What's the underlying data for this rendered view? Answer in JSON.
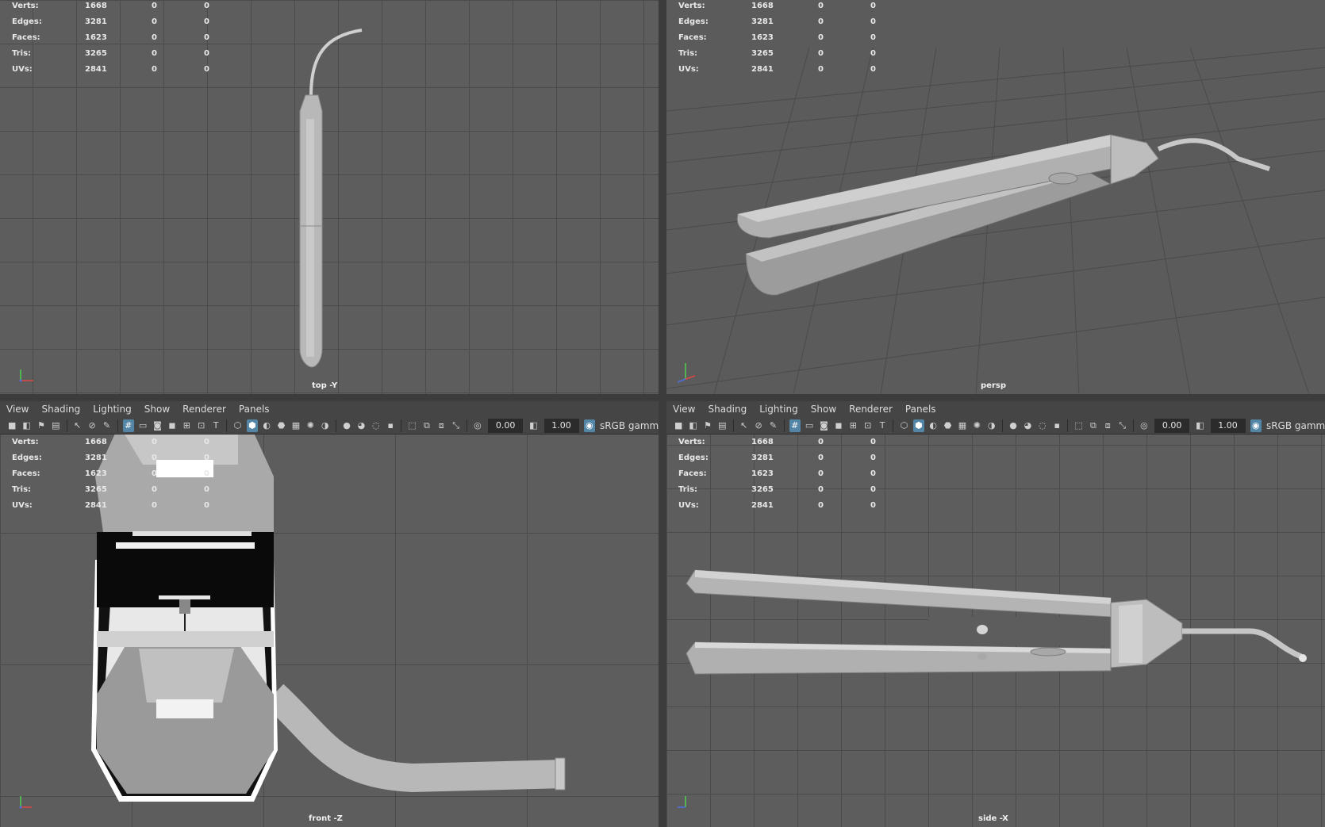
{
  "hud": {
    "rows": [
      {
        "label": "Verts:",
        "value": "1668",
        "a": "0",
        "b": "0"
      },
      {
        "label": "Edges:",
        "value": "3281",
        "a": "0",
        "b": "0"
      },
      {
        "label": "Faces:",
        "value": "1623",
        "a": "0",
        "b": "0"
      },
      {
        "label": "Tris:",
        "value": "3265",
        "a": "0",
        "b": "0"
      },
      {
        "label": "UVs:",
        "value": "2841",
        "a": "0",
        "b": "0"
      }
    ]
  },
  "viewports": {
    "top_left": {
      "camera": "top -Y"
    },
    "top_right": {
      "camera": "persp"
    },
    "bottom_left": {
      "camera": "front -Z"
    },
    "bottom_right": {
      "camera": "side -X"
    }
  },
  "menu": {
    "items": [
      "View",
      "Shading",
      "Lighting",
      "Show",
      "Renderer",
      "Panels"
    ]
  },
  "toolbar": {
    "exposure": "0.00",
    "gamma": "1.00",
    "color_space": "sRGB gamm"
  },
  "colors": {
    "viewport_bg": "#5d5d5d",
    "grid": "#4b4b4b",
    "model": "#b5b5b5",
    "highlight": "#5285a6"
  },
  "icons": [
    "camera-icon",
    "select-icon",
    "grid-icon",
    "wireframe-icon",
    "smooth-shade-icon",
    "lights-icon",
    "exposure-icon",
    "gamma-icon",
    "color-management-icon"
  ]
}
